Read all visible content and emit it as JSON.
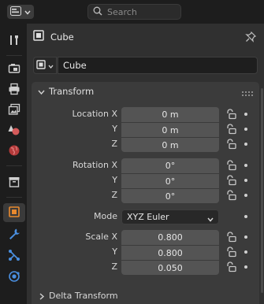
{
  "topbar": {
    "editor_icon": "properties-editor-icon",
    "search_placeholder": "Search"
  },
  "tabs": [
    {
      "name": "tool-tab",
      "icon": "wrench-screwdriver-icon",
      "color": "#cfcfcf",
      "active": false
    },
    {
      "name": "render-tab",
      "icon": "camera-back-icon",
      "color": "#cfcfcf",
      "active": false
    },
    {
      "name": "output-tab",
      "icon": "printer-icon",
      "color": "#cfcfcf",
      "active": false
    },
    {
      "name": "view-layer-tab",
      "icon": "image-stack-icon",
      "color": "#cfcfcf",
      "active": false
    },
    {
      "name": "scene-tab",
      "icon": "cone-sphere-icon",
      "color": "#d45a5a",
      "active": false
    },
    {
      "name": "world-tab",
      "icon": "world-globe-icon",
      "color": "#c04040",
      "active": false
    },
    {
      "name": "collection-tab",
      "icon": "collection-box-icon",
      "color": "#cfcfcf",
      "active": false
    },
    {
      "name": "object-tab",
      "icon": "object-square-icon",
      "color": "#e8892e",
      "active": true
    },
    {
      "name": "modifier-tab",
      "icon": "wrench-icon",
      "color": "#4a8fe0",
      "active": false
    },
    {
      "name": "particles-tab",
      "icon": "particles-icon",
      "color": "#4a8fe0",
      "active": false
    },
    {
      "name": "physics-tab",
      "icon": "physics-orbit-icon",
      "color": "#4a8fe0",
      "active": false
    }
  ],
  "header": {
    "object_name": "Cube"
  },
  "name_field": {
    "value": "Cube"
  },
  "transform": {
    "title": "Transform",
    "location": {
      "label_x": "Location X",
      "label_y": "Y",
      "label_z": "Z",
      "x": "0 m",
      "y": "0 m",
      "z": "0 m"
    },
    "rotation": {
      "label_x": "Rotation X",
      "label_y": "Y",
      "label_z": "Z",
      "x": "0°",
      "y": "0°",
      "z": "0°"
    },
    "mode": {
      "label": "Mode",
      "value": "XYZ Euler"
    },
    "scale": {
      "label_x": "Scale X",
      "label_y": "Y",
      "label_z": "Z",
      "x": "0.800",
      "y": "0.800",
      "z": "0.050"
    }
  },
  "delta_transform": {
    "title": "Delta Transform"
  },
  "colors": {
    "accent_object": "#e8892e",
    "accent_blue": "#4a8fe0",
    "panel_bg": "#303030",
    "field_bg": "#545454"
  }
}
